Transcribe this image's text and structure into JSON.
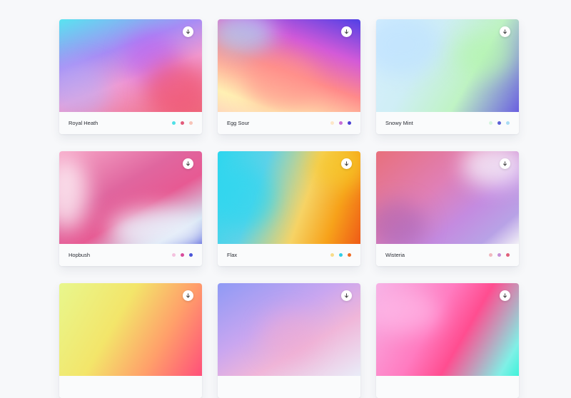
{
  "cards": [
    {
      "name": "Royal Heath",
      "dots": [
        "#4fe0e6",
        "#e25a7a",
        "#f8c4b8"
      ]
    },
    {
      "name": "Egg Sour",
      "dots": [
        "#fde7c8",
        "#c86fd6",
        "#4a3fd3"
      ]
    },
    {
      "name": "Snowy Mint",
      "dots": [
        "#d6f5df",
        "#5a5fd6",
        "#a9dcf3"
      ]
    },
    {
      "name": "Hopbush",
      "dots": [
        "#f4c2df",
        "#d84c9c",
        "#4a55d8"
      ]
    },
    {
      "name": "Flax",
      "dots": [
        "#f8dc8a",
        "#2fcde6",
        "#ef6a22"
      ]
    },
    {
      "name": "Wisteria",
      "dots": [
        "#f0b8bf",
        "#c58ed9",
        "#e0607a"
      ]
    },
    {
      "name": "",
      "dots": []
    },
    {
      "name": "",
      "dots": []
    },
    {
      "name": "",
      "dots": []
    }
  ],
  "icons": {
    "download": "download-arrow-icon"
  }
}
